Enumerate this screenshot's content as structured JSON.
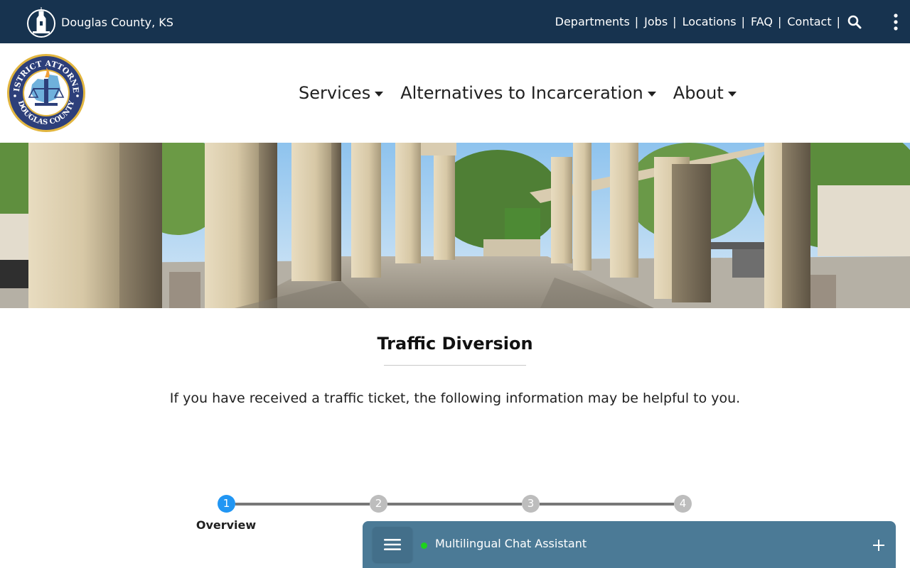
{
  "topbar": {
    "brand": "Douglas County, KS",
    "links": [
      "Departments",
      "Jobs",
      "Locations",
      "FAQ",
      "Contact"
    ],
    "separator": "|"
  },
  "nav": {
    "items": [
      "Services",
      "Alternatives to Incarceration",
      "About"
    ]
  },
  "seal": {
    "top_text": "DISTRICT ATTORNEY",
    "bottom_text": "DOUGLAS COUNTY"
  },
  "page": {
    "title": "Traffic Diversion",
    "intro": "If you have received a traffic ticket, the following information may be helpful to you."
  },
  "stepper": {
    "steps": [
      {
        "number": "1",
        "label": "Overview",
        "active": true
      },
      {
        "number": "2",
        "label": "",
        "active": false
      },
      {
        "number": "3",
        "label": "",
        "active": false
      },
      {
        "number": "4",
        "label": "",
        "active": false
      }
    ]
  },
  "chat": {
    "title": "Multilingual Chat Assistant",
    "status": "online"
  },
  "colors": {
    "topbar": "#17334f",
    "step_active": "#2196f3",
    "step_inactive": "#bdbdbd",
    "chat": "#4b7a96",
    "chat_status": "#1ed11e"
  }
}
